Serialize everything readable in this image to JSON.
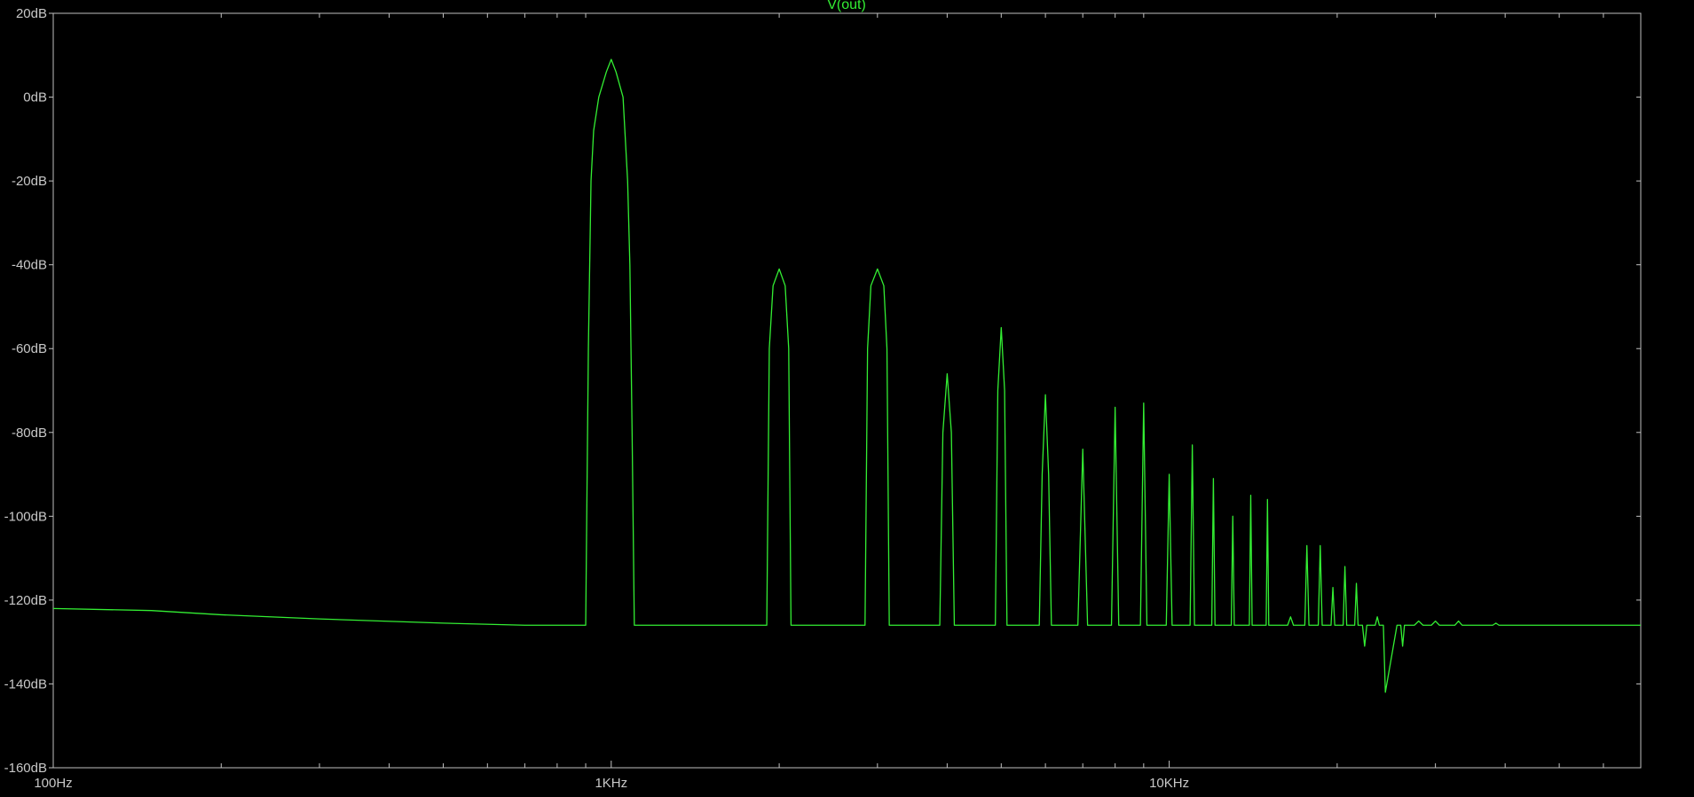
{
  "chart_data": {
    "type": "line",
    "title": "",
    "xlabel": "",
    "ylabel": "",
    "x_scale": "log",
    "xlim": [
      100,
      70000
    ],
    "ylim": [
      -160,
      20
    ],
    "x_ticks": [
      {
        "value": 100,
        "label": "100Hz"
      },
      {
        "value": 1000,
        "label": "1KHz"
      },
      {
        "value": 10000,
        "label": "10KHz"
      }
    ],
    "y_ticks": [
      {
        "value": 20,
        "label": "20dB"
      },
      {
        "value": 0,
        "label": "0dB"
      },
      {
        "value": -20,
        "label": "-20dB"
      },
      {
        "value": -40,
        "label": "-40dB"
      },
      {
        "value": -60,
        "label": "-60dB"
      },
      {
        "value": -80,
        "label": "-80dB"
      },
      {
        "value": -100,
        "label": "-100dB"
      },
      {
        "value": -120,
        "label": "-120dB"
      },
      {
        "value": -140,
        "label": "-140dB"
      },
      {
        "value": -160,
        "label": "-160dB"
      }
    ],
    "grid": false,
    "colors": {
      "background": "#000000",
      "frame": "#c0c0c0",
      "trace": "#33ee33",
      "text": "#c8c8c8"
    },
    "series": [
      {
        "name": "V(out)",
        "x": [
          100,
          150,
          200,
          300,
          500,
          700,
          900,
          910,
          920,
          930,
          950,
          980,
          1000,
          1020,
          1050,
          1070,
          1080,
          1090,
          1100,
          1800,
          1900,
          1920,
          1950,
          2000,
          2050,
          2080,
          2100,
          2200,
          2750,
          2850,
          2880,
          2920,
          3000,
          3080,
          3120,
          3150,
          3250,
          3800,
          3880,
          3930,
          4000,
          4070,
          4120,
          4200,
          4800,
          4880,
          4930,
          5000,
          5070,
          5120,
          5200,
          5850,
          5920,
          6000,
          6080,
          6150,
          6750,
          6860,
          7000,
          7140,
          7250,
          7800,
          7880,
          8000,
          8120,
          8200,
          8800,
          8880,
          9000,
          9120,
          9200,
          9800,
          9880,
          10000,
          10120,
          10200,
          10850,
          10900,
          11000,
          11100,
          11150,
          11850,
          11920,
          12000,
          12080,
          12150,
          12850,
          12920,
          13000,
          13080,
          13150,
          13850,
          13920,
          14000,
          14080,
          14150,
          14850,
          14920,
          15000,
          15080,
          15150,
          16300,
          16500,
          16700,
          17400,
          17500,
          17650,
          17800,
          18400,
          18500,
          18650,
          18800,
          19400,
          19500,
          19650,
          19800,
          20400,
          20500,
          20650,
          20800,
          21400,
          21500,
          21650,
          21800,
          22200,
          22400,
          22600,
          23400,
          23600,
          23800,
          24000,
          24200,
          24400,
          25600,
          25800,
          26000,
          26200,
          26400,
          27500,
          28000,
          28500,
          29500,
          30000,
          30500,
          32500,
          33000,
          33500,
          38000,
          38500,
          39000,
          45000,
          70000
        ],
        "y": [
          -122,
          -122.5,
          -123.5,
          -124.5,
          -125.5,
          -126,
          -126,
          -60,
          -20,
          -8,
          0,
          6,
          9,
          6,
          0,
          -20,
          -40,
          -80,
          -126,
          -126,
          -126,
          -60,
          -45,
          -41,
          -45,
          -60,
          -126,
          -126,
          -126,
          -126,
          -60,
          -45,
          -41,
          -45,
          -60,
          -126,
          -126,
          -126,
          -126,
          -80,
          -66,
          -80,
          -126,
          -126,
          -126,
          -126,
          -70,
          -55,
          -70,
          -126,
          -126,
          -126,
          -90,
          -71,
          -90,
          -126,
          -126,
          -126,
          -84,
          -126,
          -126,
          -126,
          -126,
          -74,
          -126,
          -126,
          -126,
          -126,
          -73,
          -126,
          -126,
          -126,
          -126,
          -90,
          -126,
          -126,
          -126,
          -126,
          -83,
          -126,
          -126,
          -126,
          -126,
          -91,
          -126,
          -126,
          -126,
          -126,
          -100,
          -126,
          -126,
          -126,
          -126,
          -95,
          -126,
          -126,
          -126,
          -126,
          -96,
          -126,
          -126,
          -126,
          -124,
          -126,
          -126,
          -126,
          -107,
          -126,
          -126,
          -126,
          -107,
          -126,
          -126,
          -126,
          -117,
          -126,
          -126,
          -126,
          -112,
          -126,
          -126,
          -126,
          -116,
          -126,
          -126,
          -131,
          -126,
          -126,
          -124,
          -126,
          -126,
          -126,
          -142,
          -126,
          -126,
          -126,
          -131,
          -126,
          -126,
          -125,
          -126,
          -126,
          -125,
          -126,
          -126,
          -125,
          -126,
          -126,
          -125.5,
          -126,
          -126,
          -126
        ]
      }
    ]
  }
}
